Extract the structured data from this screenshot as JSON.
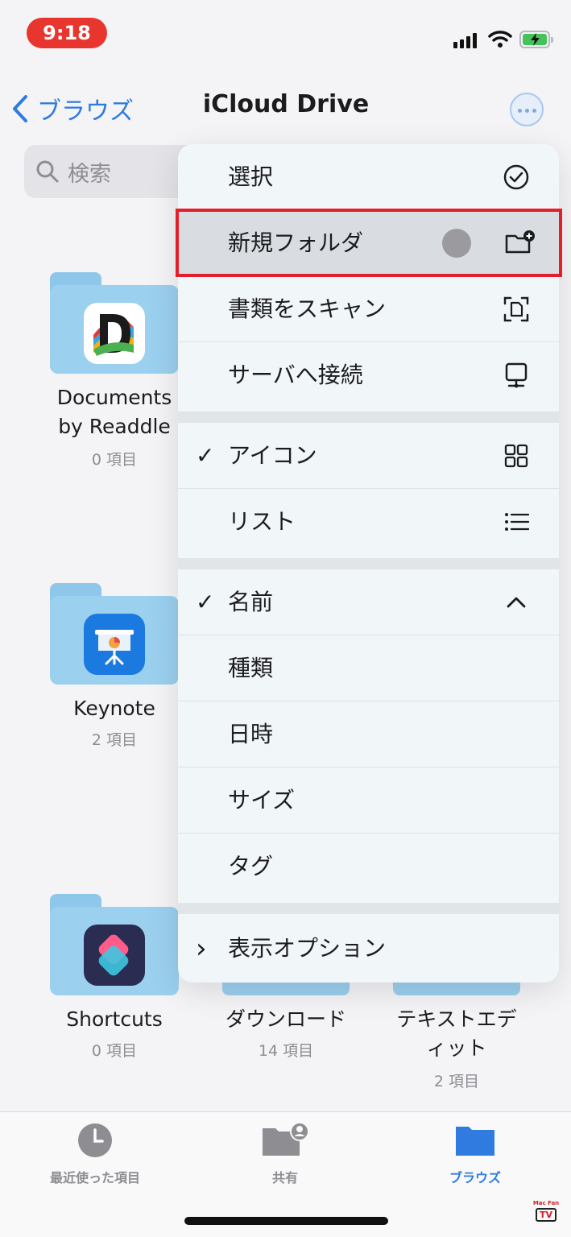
{
  "status_bar": {
    "time": "9:18"
  },
  "nav": {
    "back_label": "ブラウズ",
    "title": "iCloud Drive"
  },
  "search": {
    "placeholder": "検索"
  },
  "folders": [
    {
      "name_line1": "Documents",
      "name_line2": "by Readdle",
      "count": "0 項目"
    },
    {
      "name_line1": "Keynote",
      "count": "2 項目"
    },
    {
      "name_line1": "Shortcuts",
      "count": "0 項目"
    },
    {
      "name_line1": "ダウンロード",
      "count": "14 項目"
    },
    {
      "name_line1": "テキストエデ",
      "name_line2": "ィット",
      "count": "2 項目"
    }
  ],
  "menu": {
    "items": [
      {
        "label": "選択",
        "icon": "checkmark-circle-icon"
      },
      {
        "label": "新規フォルダ",
        "icon": "folder-plus-icon",
        "highlighted": true
      },
      {
        "label": "書類をスキャン",
        "icon": "doc-scan-icon"
      },
      {
        "label": "サーバへ接続",
        "icon": "display-icon"
      }
    ],
    "view_items": [
      {
        "label": "アイコン",
        "checked": true,
        "check": "✓",
        "icon": "grid-icon"
      },
      {
        "label": "リスト",
        "icon": "list-icon"
      }
    ],
    "sort_items": [
      {
        "label": "名前",
        "checked": true,
        "check": "✓",
        "icon": "chevron-up-icon"
      },
      {
        "label": "種類"
      },
      {
        "label": "日時"
      },
      {
        "label": "サイズ"
      },
      {
        "label": "タグ"
      }
    ],
    "options": {
      "label": "表示オプション",
      "chevron": "›"
    }
  },
  "tabbar": {
    "tabs": [
      {
        "label": "最近使った項目",
        "icon": "clock-icon",
        "active": false
      },
      {
        "label": "共有",
        "icon": "shared-folder-icon",
        "active": false
      },
      {
        "label": "ブラウズ",
        "icon": "folder-icon",
        "active": true
      }
    ]
  },
  "watermark": {
    "line1": "Mac Fan",
    "line2": "TV"
  },
  "colors": {
    "accent": "#2f7be0",
    "highlight_frame": "#e3202a",
    "folder": "#9bd0ef"
  }
}
